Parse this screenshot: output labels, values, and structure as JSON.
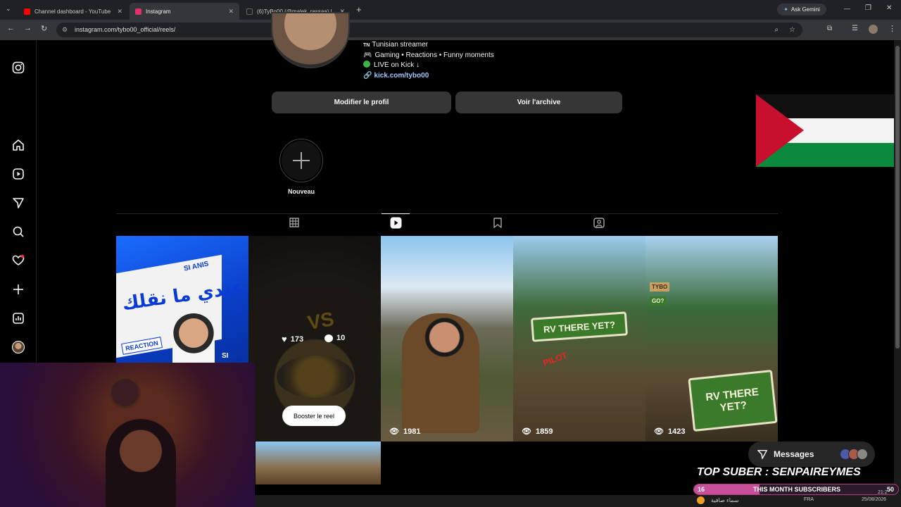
{
  "browser": {
    "tabs": [
      {
        "title": "Channel dashboard - YouTube"
      },
      {
        "title": "Instagram"
      },
      {
        "title": "(6)TyBo00 (@malek_rassaa) | Ti"
      }
    ],
    "ask_gemini": "Ask Gemini",
    "url": "instagram.com/tybo00_official/reels/"
  },
  "profile": {
    "bio_line1": "Tunisian streamer",
    "bio_line1_prefix": "TN",
    "bio_line2": "Gaming • Reactions • Funny moments",
    "bio_line3": "LIVE on Kick ↓",
    "link": "kick.com/tybo00",
    "edit_button": "Modifier le profil",
    "archive_button": "Voir l'archive",
    "new_highlight": "Nouveau"
  },
  "reels": [
    {
      "likes": "173",
      "comments": "10",
      "boost": "Booster le reel"
    },
    {
      "views": "1981"
    },
    {
      "views": "1859"
    },
    {
      "views": "1423"
    }
  ],
  "thumb_text": {
    "reaction": "REACTION",
    "si_anis": "SI ANIS",
    "si": "SI",
    "arabic": "عندي ما نقلك",
    "rv1": "RV THERE YET?",
    "pilot": "PILOT",
    "rv2_line1": "RV THERE",
    "rv2_line2": "YET?",
    "vs": "VS",
    "go": "GO?",
    "tybo": "TYBO"
  },
  "messages": {
    "label": "Messages"
  },
  "overlay": {
    "top_suber": "TOP SUBER : SENPAIREYMES",
    "subs_count": "16",
    "subs_label": "THIS MONTH SUBSCRIBERS",
    "subs_goal": "50"
  },
  "taskbar": {
    "weather": "سماء صافية",
    "lang": "FRA",
    "time": "21:2",
    "date": "25/08/2026"
  },
  "colors": {
    "accent_link": "#e0f1ff",
    "bg": "#000000",
    "button": "#363636",
    "palestine_red": "#c8102e",
    "palestine_green": "#007a3d"
  }
}
